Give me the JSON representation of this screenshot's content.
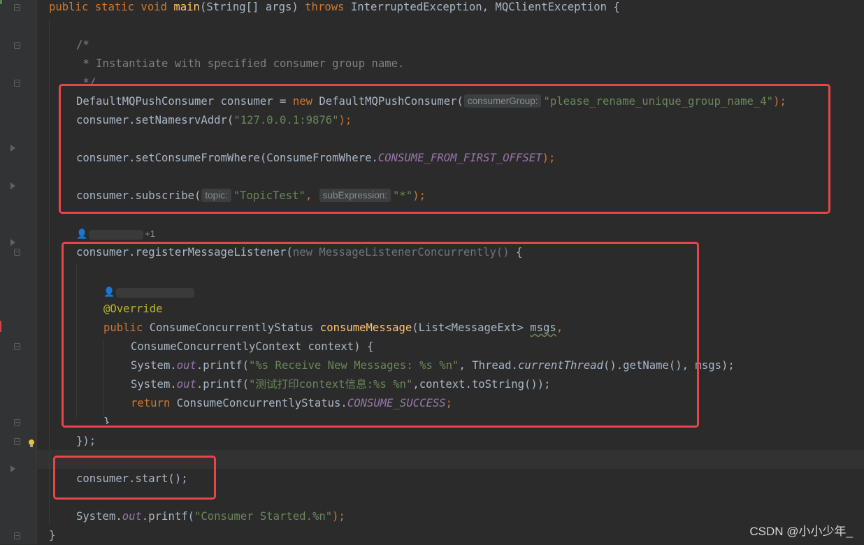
{
  "editor": {
    "lines": {
      "l1": {
        "t1": "public static void ",
        "t2": "main",
        "t3": "(String[] args) ",
        "t4": "throws ",
        "t5": "InterruptedException, MQClientException {"
      },
      "l2": {
        "t1": "/*"
      },
      "l3": {
        "t1": " * Instantiate with specified consumer group name."
      },
      "l4": {
        "t1": " */"
      },
      "l5": {
        "t1": "DefaultMQPushConsumer consumer = ",
        "t2": "new ",
        "t3": "DefaultMQPushConsumer(",
        "hint": "consumerGroup:",
        "t4": "\"please_rename_unique_group_name_4\"",
        "t5": ");"
      },
      "l6": {
        "t1": "consumer.setNamesrvAddr(",
        "t2": "\"127.0.0.1:9876\"",
        "t3": ");"
      },
      "l7": {
        "t1": "consumer.setConsumeFromWhere(ConsumeFromWhere.",
        "t2": "CONSUME_FROM_FIRST_OFFSET",
        "t3": ");"
      },
      "l8": {
        "t1": "consumer.subscribe(",
        "hint1": "topic:",
        "t2": "\"TopicTest\"",
        "t3": ", ",
        "hint2": "subExpression:",
        "t4": "\"*\"",
        "t5": ");"
      },
      "l9": {
        "t1": "consumer.registerMessageListener(",
        "t2": "new MessageListenerConcurrently() ",
        "t3": "{"
      },
      "l10": {
        "t1": "@Override"
      },
      "l11": {
        "t1": "public ",
        "t2": "ConsumeConcurrentlyStatus ",
        "t3": "consumeMessage",
        "t4": "(List<MessageExt> ",
        "t5": "msgs",
        "t6": ","
      },
      "l12": {
        "t1": "ConsumeConcurrentlyContext context) {"
      },
      "l13": {
        "t1": "System.",
        "t2": "out",
        "t3": ".printf(",
        "t4": "\"%s Receive New Messages: %s %n\"",
        "t5": ", Thread.",
        "t6": "currentThread",
        "t7": "().getName(), msgs);"
      },
      "l14": {
        "t1": "System.",
        "t2": "out",
        "t3": ".printf(",
        "t4": "\"测试打印context信息:%s %n\"",
        "t5": ",context.toString());"
      },
      "l15": {
        "t1": "return ",
        "t2": "ConsumeConcurrentlyStatus.",
        "t3": "CONSUME_SUCCESS",
        "t4": ";"
      },
      "l16": {
        "t1": "}"
      },
      "l17": {
        "t1": "});"
      },
      "l18": {
        "t1": "consumer.start();"
      },
      "l19": {
        "t1": "System.",
        "t2": "out",
        "t3": ".printf(",
        "t4": "\"Consumer Started.%n\"",
        "t5": ");"
      },
      "l20": {
        "t1": "}"
      }
    },
    "author_hint_1": {
      "suffix": "+1"
    },
    "watermark": "CSDN @小小少年_"
  },
  "icons": {
    "fold": "fold-icon",
    "expand": "expand-arrow-icon",
    "bulb": "lightbulb-icon",
    "user": "user-icon"
  },
  "colors": {
    "background": "#2b2b2b",
    "keyword": "#cc7832",
    "string": "#6a8759",
    "method": "#ffc66d",
    "static_field": "#9876aa",
    "annotation": "#bbb529",
    "highlight_box": "#e8454a"
  }
}
